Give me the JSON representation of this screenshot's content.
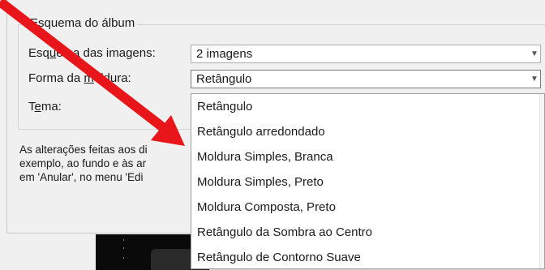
{
  "album": {
    "group_title": "Esquema do álbum",
    "layout_label_pre": "Esq",
    "layout_label_u": "u",
    "layout_label_post": "ema das imagens:",
    "layout_value": "2 imagens",
    "frame_label_pre": "Forma da ",
    "frame_label_u": "m",
    "frame_label_post": "oldura:",
    "frame_value": "Retângulo",
    "theme_label_pre": "T",
    "theme_label_u": "e",
    "theme_label_post": "ma:"
  },
  "description": {
    "line1": "As alterações feitas aos di",
    "line2": "exemplo, ao fundo e às ar",
    "line3": "em 'Anular', no menu 'Edi"
  },
  "dropdown": {
    "options": [
      "Retângulo",
      "Retângulo arredondado",
      "Moldura Simples, Branca",
      "Moldura Simples, Preto",
      "Moldura Composta, Preto",
      "Retângulo da Sombra ao Centro",
      "Retângulo de Contorno Suave"
    ]
  },
  "icons": {
    "dropdown_arrow": "chevron-down-icon",
    "annotation": "red-arrow"
  },
  "colors": {
    "annotation_red": "#e8161b",
    "dialog_bg": "#f0f0f0"
  }
}
